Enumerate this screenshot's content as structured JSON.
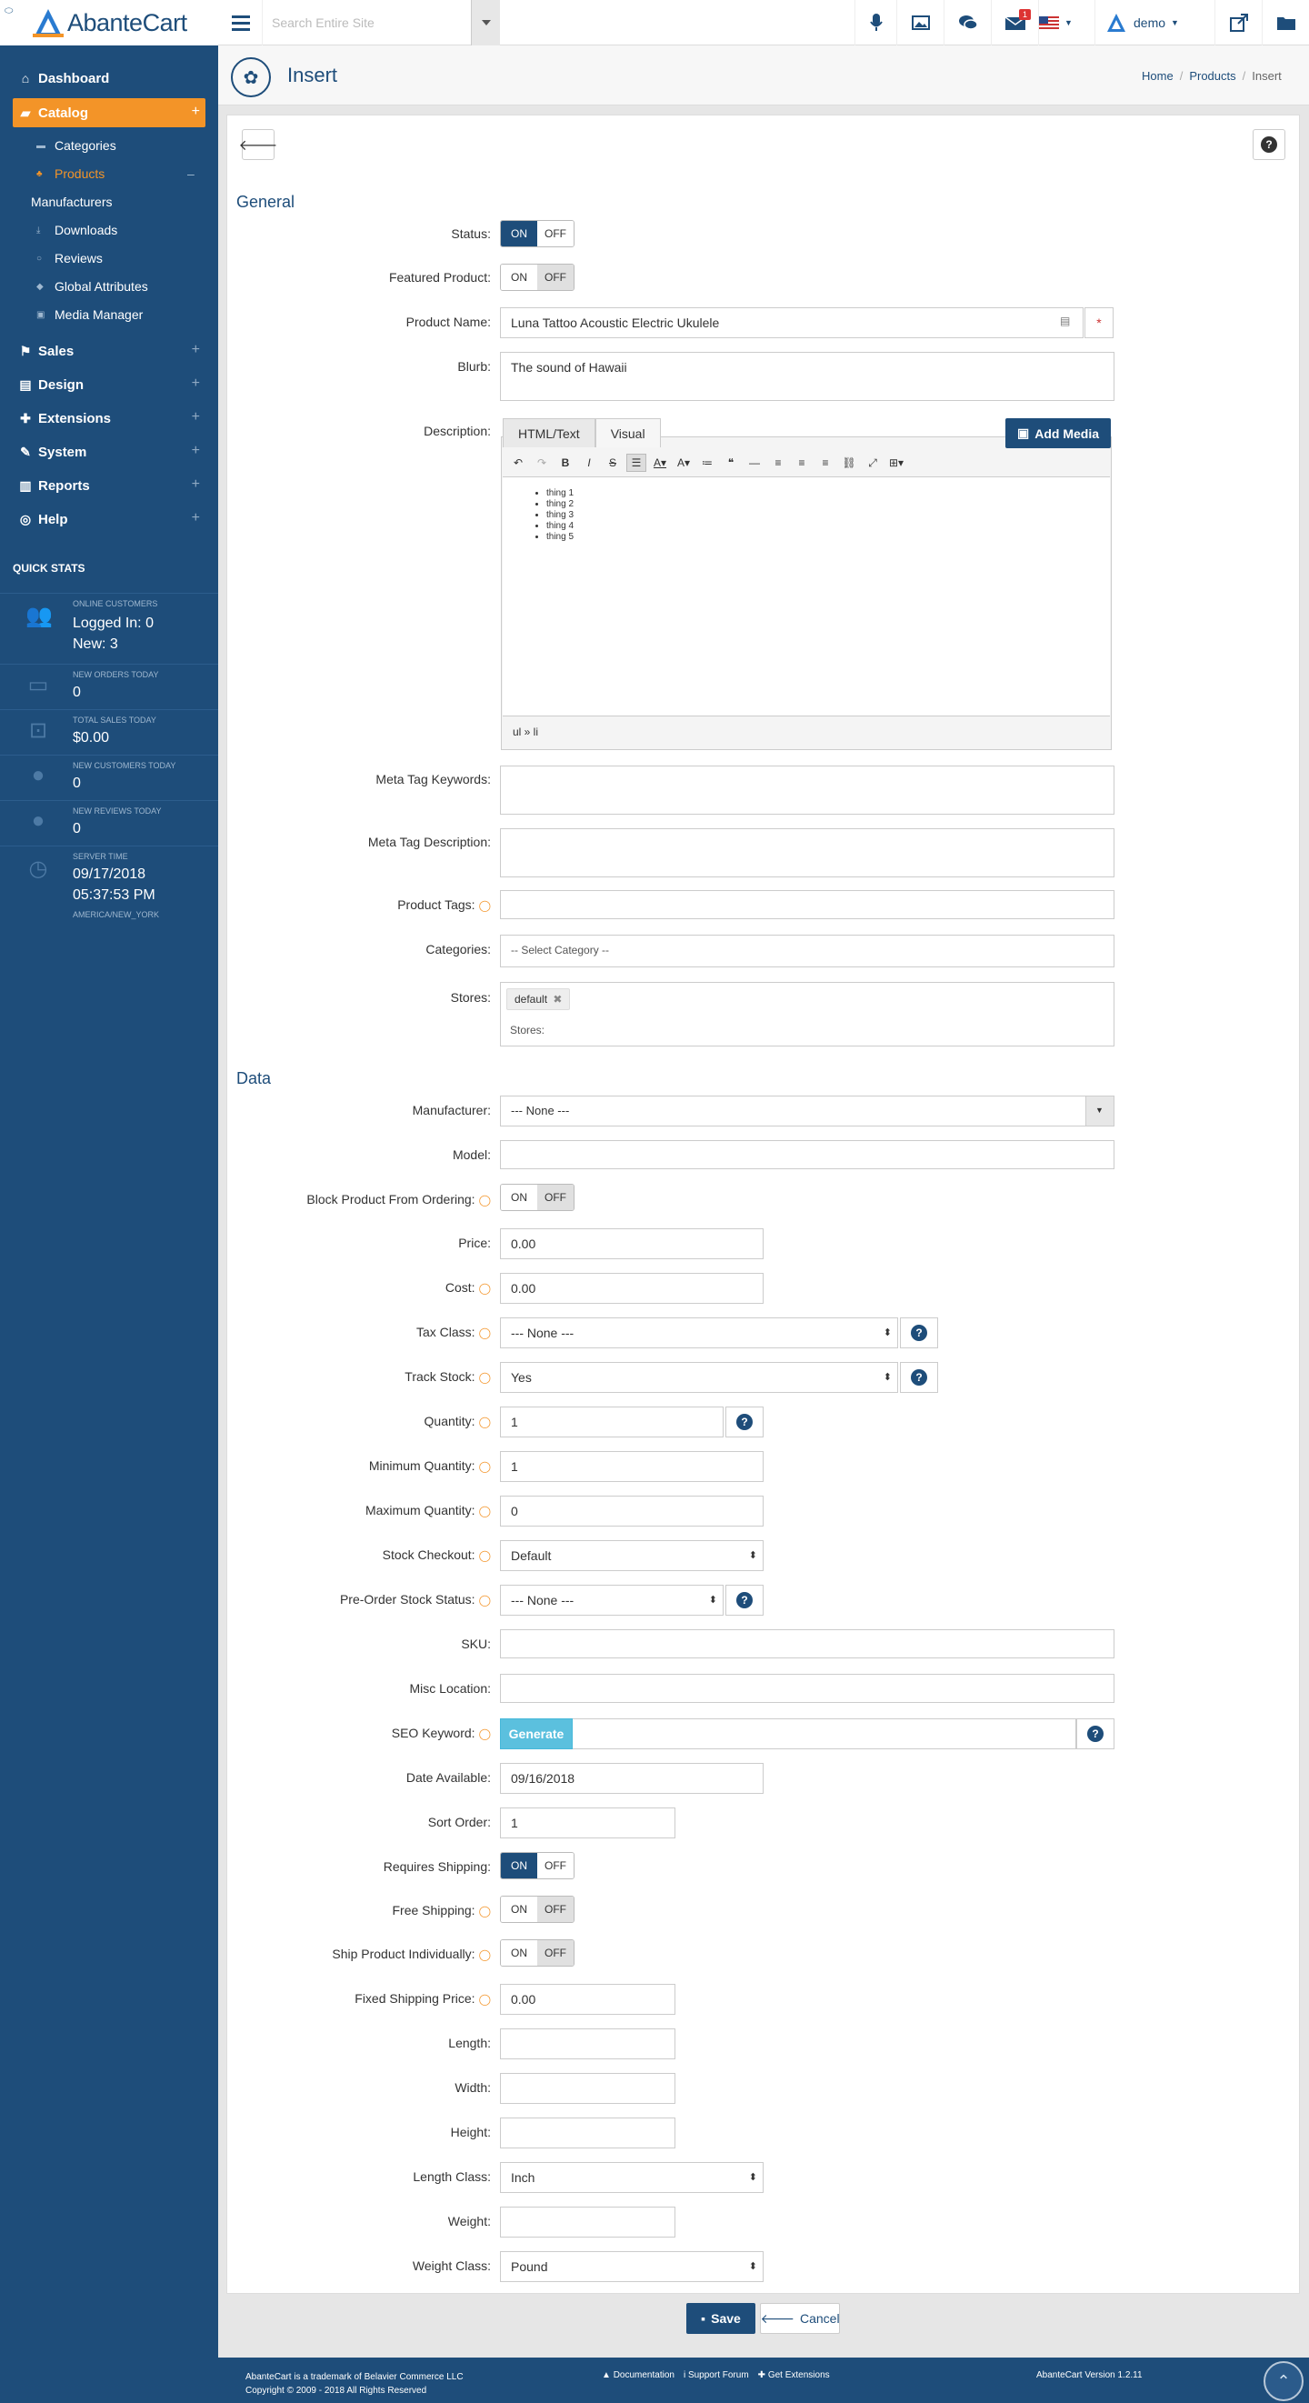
{
  "app": {
    "name": "AbanteCart"
  },
  "topbar": {
    "search_placeholder": "Search Entire Site",
    "mail_count": "1",
    "user": "demo"
  },
  "sidebar": {
    "items": [
      {
        "label": "Dashboard",
        "icon": "dashboard-icon"
      },
      {
        "label": "Catalog",
        "icon": "folder-open-icon"
      },
      {
        "label": "Sales",
        "icon": "flag-icon"
      },
      {
        "label": "Design",
        "icon": "file-icon"
      },
      {
        "label": "Extensions",
        "icon": "puzzle-icon"
      },
      {
        "label": "System",
        "icon": "wrench-icon"
      },
      {
        "label": "Reports",
        "icon": "bar-chart-icon"
      },
      {
        "label": "Help",
        "icon": "life-ring-icon"
      }
    ],
    "catalog_items": [
      {
        "label": "Categories"
      },
      {
        "label": "Products"
      },
      {
        "label": "Manufacturers"
      },
      {
        "label": "Downloads"
      },
      {
        "label": "Reviews"
      },
      {
        "label": "Global Attributes"
      },
      {
        "label": "Media Manager"
      }
    ],
    "quick_stats_title": "QUICK STATS",
    "stats": {
      "online_label": "ONLINE CUSTOMERS",
      "online_logged": "Logged In: 0",
      "online_new": "New: 3",
      "orders_label": "NEW ORDERS TODAY",
      "orders_value": "0",
      "sales_label": "TOTAL SALES TODAY",
      "sales_value": "$0.00",
      "customers_label": "NEW CUSTOMERS TODAY",
      "customers_value": "0",
      "reviews_label": "NEW REVIEWS TODAY",
      "reviews_value": "0",
      "server_label": "SERVER TIME",
      "server_date": "09/17/2018",
      "server_time": "05:37:53 PM",
      "server_tz": "AMERICA/NEW_YORK"
    }
  },
  "header": {
    "title": "Insert",
    "breadcrumb": [
      "Home",
      "Products",
      "Insert"
    ]
  },
  "form": {
    "general_title": "General",
    "data_title": "Data",
    "status_label": "Status:",
    "featured_label": "Featured Product:",
    "product_name_label": "Product Name:",
    "product_name_value": "Luna Tattoo Acoustic Electric Ukulele",
    "blurb_label": "Blurb:",
    "blurb_value": "The sound of Hawaii",
    "description_label": "Description:",
    "tab_html": "HTML/Text",
    "tab_visual": "Visual",
    "add_media": "Add Media",
    "description_items": [
      "thing 1",
      "thing 2",
      "thing 3",
      "thing 4",
      "thing 5"
    ],
    "editor_path": "ul » li",
    "meta_keywords_label": "Meta Tag Keywords:",
    "meta_description_label": "Meta Tag Description:",
    "tags_label": "Product Tags:",
    "categories_label": "Categories:",
    "categories_placeholder": "-- Select Category --",
    "stores_label": "Stores:",
    "stores_chip": "default",
    "stores_placeholder": "Stores:",
    "manufacturer_label": "Manufacturer:",
    "manufacturer_value": "--- None ---",
    "model_label": "Model:",
    "block_label": "Block Product From Ordering:",
    "price_label": "Price:",
    "price_value": "0.00",
    "cost_label": "Cost:",
    "cost_value": "0.00",
    "tax_label": "Tax Class:",
    "tax_value": "--- None ---",
    "track_label": "Track Stock:",
    "track_value": "Yes",
    "qty_label": "Quantity:",
    "qty_value": "1",
    "min_qty_label": "Minimum Quantity:",
    "min_qty_value": "1",
    "max_qty_label": "Maximum Quantity:",
    "max_qty_value": "0",
    "stock_checkout_label": "Stock Checkout:",
    "stock_checkout_value": "Default",
    "preorder_label": "Pre-Order Stock Status:",
    "preorder_value": "--- None ---",
    "sku_label": "SKU:",
    "misc_label": "Misc Location:",
    "seo_label": "SEO Keyword:",
    "generate": "Generate",
    "date_label": "Date Available:",
    "date_value": "09/16/2018",
    "sort_label": "Sort Order:",
    "sort_value": "1",
    "req_ship_label": "Requires Shipping:",
    "free_ship_label": "Free Shipping:",
    "ship_ind_label": "Ship Product Individually:",
    "fixed_ship_label": "Fixed Shipping Price:",
    "fixed_ship_value": "0.00",
    "length_label": "Length:",
    "width_label": "Width:",
    "height_label": "Height:",
    "length_class_label": "Length Class:",
    "length_class_value": "Inch",
    "weight_label": "Weight:",
    "weight_class_label": "Weight Class:",
    "weight_class_value": "Pound",
    "on": "ON",
    "off": "OFF",
    "save": "Save",
    "cancel": "Cancel"
  },
  "footer": {
    "line1": "AbanteCart is a trademark of Belavier Commerce LLC",
    "line2": "Copyright © 2009 - 2018 All Rights Reserved",
    "docs": "Documentation",
    "forum": "Support Forum",
    "ext": "Get Extensions",
    "version": "AbanteCart Version 1.2.11"
  },
  "colors": {
    "primary": "#1e4d7a",
    "accent": "#f39428",
    "info": "#5bc0de"
  }
}
